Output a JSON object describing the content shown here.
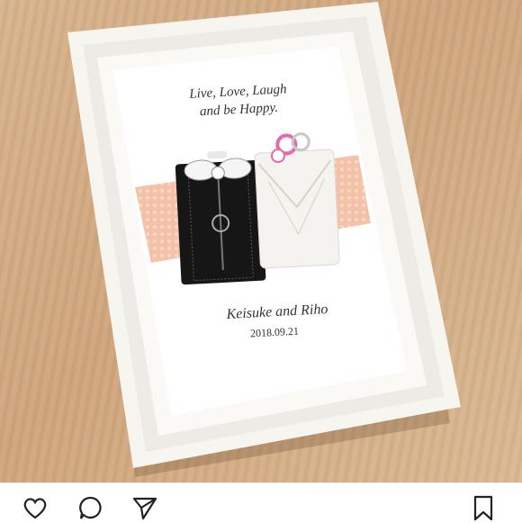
{
  "post": {
    "card": {
      "tagline_line1": "Live, Love, Laugh",
      "tagline_line2": "and be Happy.",
      "names": "Keisuke and Riho",
      "date": "2018.09.21"
    }
  },
  "actions": {
    "like_icon": "heart-icon",
    "comment_icon": "comment-icon",
    "share_icon": "send-icon",
    "save_icon": "bookmark-icon"
  },
  "colors": {
    "frame": "#f7f5f0",
    "background": "#d7b48e",
    "ribbon": "#f3c2a8",
    "black_charm": "#161616",
    "white_charm": "#f5f3ef",
    "pink_knot": "#e56aa8"
  }
}
